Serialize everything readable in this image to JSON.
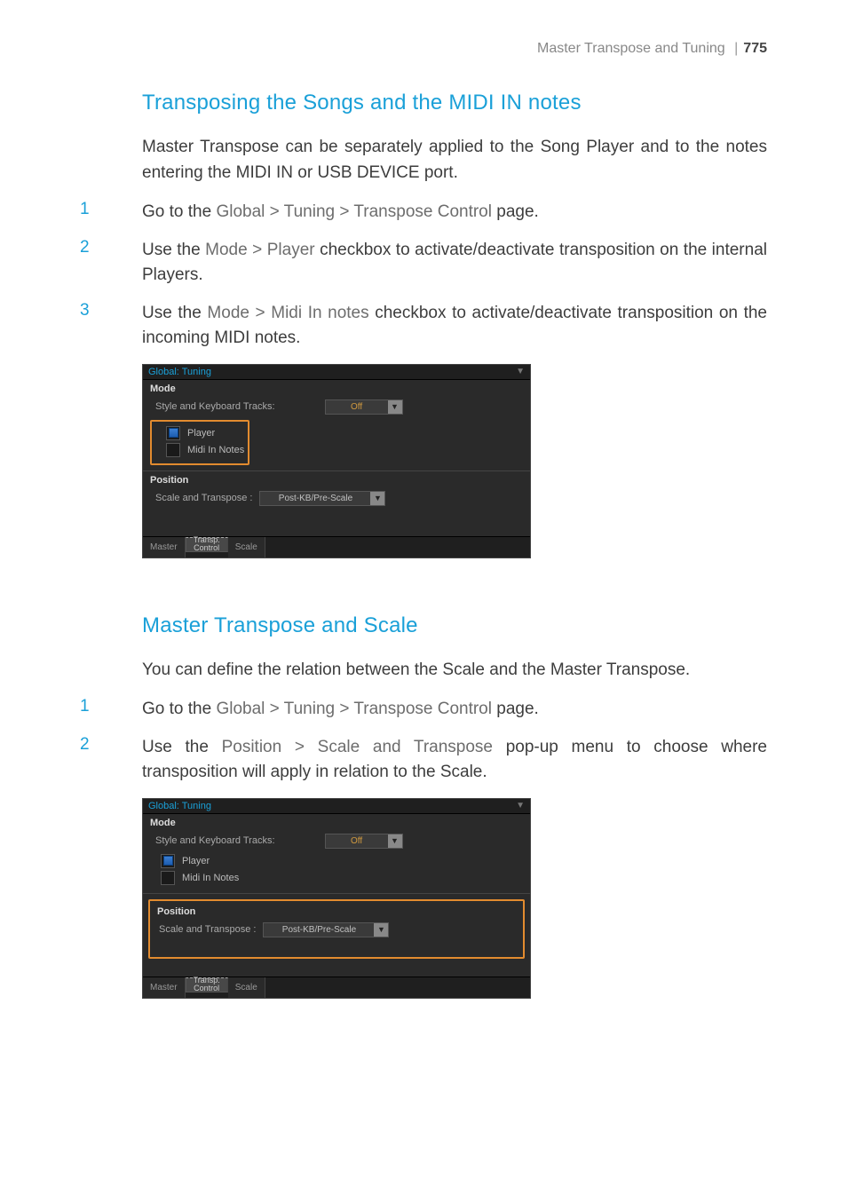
{
  "header": {
    "section": "Master Transpose and Tuning",
    "separator": "|",
    "page": "775"
  },
  "s1": {
    "title": "Transposing the Songs and the MIDI IN notes",
    "intro": "Master Transpose can be separately applied to the Song Player and to the notes entering the MIDI IN or USB DEVICE port.",
    "step1": {
      "num": "1",
      "pre": "Go to the ",
      "path": "Global > Tuning > Transpose Control",
      "post": " page."
    },
    "step2": {
      "num": "2",
      "pre": "Use the ",
      "path": "Mode > Player",
      "post": " checkbox to activate/deactivate transposition on the internal Players."
    },
    "step3": {
      "num": "3",
      "pre": "Use the ",
      "path": "Mode > Midi In notes",
      "post": " checkbox to activate/deactivate transposition on the incoming MIDI notes."
    }
  },
  "s2": {
    "title": "Master Transpose and Scale",
    "intro": "You can define the relation between the Scale and the Master Transpose.",
    "step1": {
      "num": "1",
      "pre": "Go to the ",
      "path": "Global > Tuning > Transpose Control",
      "post": " page."
    },
    "step2": {
      "num": "2",
      "pre": "Use the ",
      "path": "Position > Scale and Transpose",
      "post": " pop-up menu to choose where transposition will apply in relation to the Scale."
    }
  },
  "shot": {
    "title": "Global: Tuning",
    "mode_label": "Mode",
    "skt_label": "Style and Keyboard Tracks:",
    "skt_value": "Off",
    "player_label": "Player",
    "midi_label": "Midi In Notes",
    "position_label": "Position",
    "sat_label": "Scale and Transpose :",
    "sat_value": "Post-KB/Pre-Scale",
    "tab_master": "Master",
    "tab_transp_l1": "Transp.",
    "tab_transp_l2": "Control",
    "tab_scale": "Scale",
    "caret": "▼"
  }
}
